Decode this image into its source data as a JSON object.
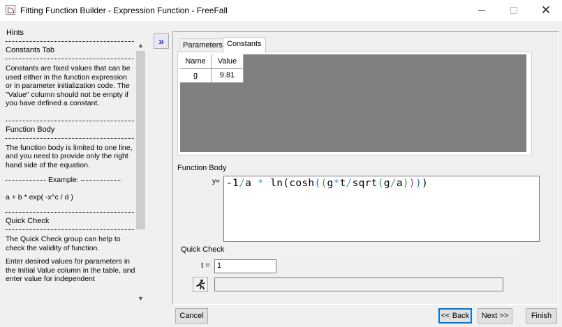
{
  "window": {
    "title": "Fitting Function Builder - Expression Function - FreeFall"
  },
  "hints": {
    "label": "Hints",
    "sections": [
      {
        "heading": "Constants Tab",
        "text": "Constants are fixed values that can be used either in the function expression or in parameter initialization code. The \"Value\" column should not be empty if you have defined a constant."
      },
      {
        "heading": "Function Body",
        "text": "The function body is limited to one line, and you need to provide only the right hand side of the equation."
      },
      {
        "example_label": "Example:",
        "example": "a + b * exp( -x^c / d )"
      },
      {
        "heading": "Quick Check",
        "text": "The Quick Check group can help to check the validity of function.",
        "text2": "Enter desired values for parameters in the Initial Value column in the table, and enter value for independent"
      }
    ]
  },
  "tabs": [
    {
      "label": "Parameters",
      "active": false
    },
    {
      "label": "Constants",
      "active": true
    }
  ],
  "constants_table": {
    "headers": [
      "Name",
      "Value"
    ],
    "rows": [
      [
        "g",
        "9.81"
      ]
    ]
  },
  "function_body": {
    "label": "Function Body",
    "y_label": "y=",
    "tokens": [
      {
        "t": "-1",
        "c": "#000"
      },
      {
        "t": "/",
        "c": "#4aa3c8"
      },
      {
        "t": "a ",
        "c": "#000"
      },
      {
        "t": "*",
        "c": "#4aa3c8"
      },
      {
        "t": " ln",
        "c": "#000"
      },
      {
        "t": "(",
        "c": "#000"
      },
      {
        "t": "cosh",
        "c": "#000"
      },
      {
        "t": "(",
        "c": "#1f6fd1"
      },
      {
        "t": "(",
        "c": "#2fa83a"
      },
      {
        "t": "g",
        "c": "#000"
      },
      {
        "t": "*",
        "c": "#4aa3c8"
      },
      {
        "t": "t",
        "c": "#000"
      },
      {
        "t": "/",
        "c": "#4aa3c8"
      },
      {
        "t": "sqrt",
        "c": "#000"
      },
      {
        "t": "(",
        "c": "#2fa83a"
      },
      {
        "t": "g",
        "c": "#000"
      },
      {
        "t": "/",
        "c": "#4aa3c8"
      },
      {
        "t": "a",
        "c": "#000"
      },
      {
        "t": ")",
        "c": "#2fa83a"
      },
      {
        "t": ")",
        "c": "#a033c0"
      },
      {
        "t": ")",
        "c": "#1f6fd1"
      },
      {
        "t": ")",
        "c": "#000"
      }
    ]
  },
  "quick_check": {
    "label": "Quick Check",
    "t_label": "t =",
    "t_value": "1",
    "run_icon": "running-man-icon",
    "result": ""
  },
  "buttons": {
    "cancel": "Cancel",
    "back": "<< Back",
    "next": "Next >>",
    "finish": "Finish",
    "expand": "»"
  }
}
